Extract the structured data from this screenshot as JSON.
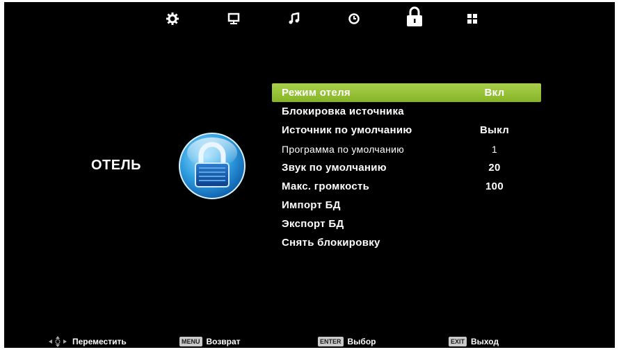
{
  "tabs": [
    {
      "icon": "picture-gear-icon"
    },
    {
      "icon": "monitor-icon"
    },
    {
      "icon": "music-note-icon"
    },
    {
      "icon": "clock-icon"
    },
    {
      "icon": "lock-icon",
      "active": true
    },
    {
      "icon": "grid-apps-icon"
    }
  ],
  "section": {
    "title": "ОТЕЛЬ",
    "icon": "padlock-badge-icon"
  },
  "menu": {
    "items": [
      {
        "label": "Режим отеля",
        "value": "Вкл",
        "selected": true
      },
      {
        "label": "Блокировка источника",
        "value": ""
      },
      {
        "label": "Источник по умолчанию",
        "value": "Выкл"
      },
      {
        "label": "Программа по умолчанию",
        "value": "1"
      },
      {
        "label": "Звук по умолчанию",
        "value": "20"
      },
      {
        "label": "Макс. громкость",
        "value": "100"
      },
      {
        "label": "Импорт БД",
        "value": ""
      },
      {
        "label": "Экспорт БД",
        "value": ""
      },
      {
        "label": "Снять блокировку",
        "value": ""
      }
    ]
  },
  "hints": {
    "move": "Переместить",
    "back_key": "MENU",
    "back": "Возврат",
    "select_key": "ENTER",
    "select": "Выбор",
    "exit_key": "EXIT",
    "exit": "Выход"
  },
  "colors": {
    "background": "#000000",
    "selected_row": "#96c23a",
    "text": "#ffffff"
  }
}
